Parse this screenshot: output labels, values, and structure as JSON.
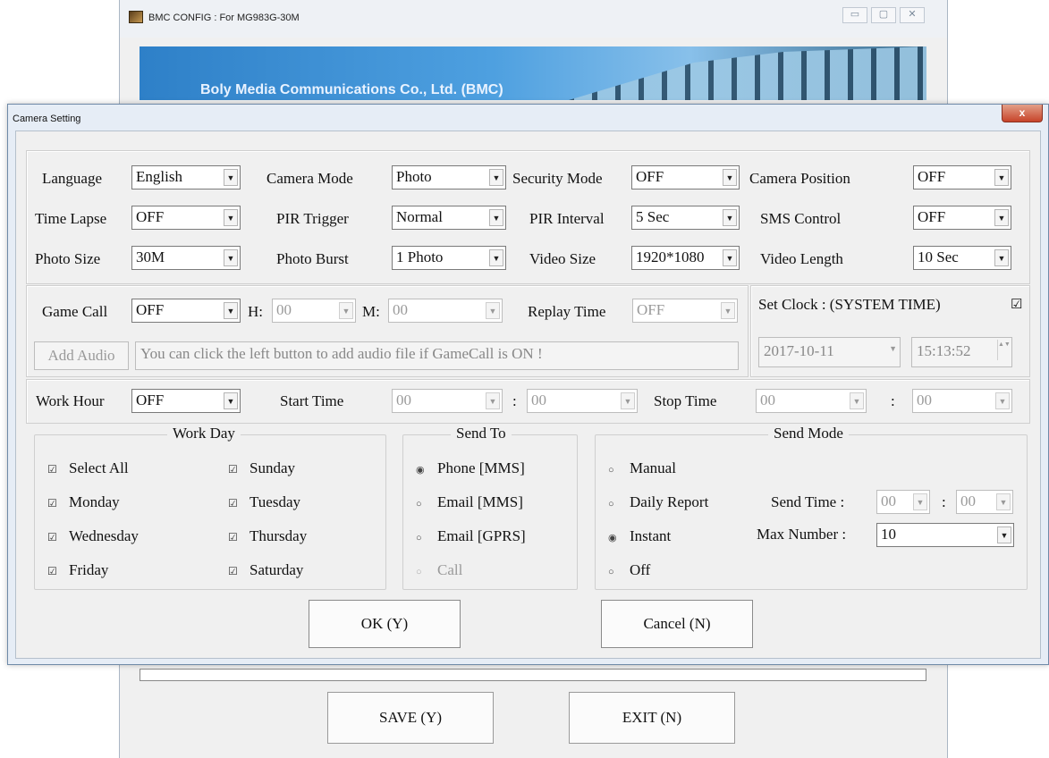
{
  "parent_window": {
    "title": "BMC CONFIG : For MG983G-30M",
    "controls": [
      "▭",
      "▢",
      "✕"
    ],
    "banner_text": "Boly Media Communications Co., Ltd. (BMC)",
    "save_label": "SAVE (Y)",
    "exit_label": "EXIT (N)"
  },
  "dialog": {
    "title": "Camera Setting",
    "close_glyph": "x",
    "row1": {
      "language_label": "Language",
      "language_value": "English",
      "camera_mode_label": "Camera Mode",
      "camera_mode_value": "Photo",
      "security_mode_label": "Security Mode",
      "security_mode_value": "OFF",
      "camera_position_label": "Camera Position",
      "camera_position_value": "OFF"
    },
    "row2": {
      "time_lapse_label": "Time Lapse",
      "time_lapse_value": "OFF",
      "pir_trigger_label": "PIR Trigger",
      "pir_trigger_value": "Normal",
      "pir_interval_label": "PIR Interval",
      "pir_interval_value": "5  Sec",
      "sms_control_label": "SMS Control",
      "sms_control_value": "OFF"
    },
    "row3": {
      "photo_size_label": "Photo Size",
      "photo_size_value": "30M",
      "photo_burst_label": "Photo Burst",
      "photo_burst_value": "1 Photo",
      "video_size_label": "Video Size",
      "video_size_value": "1920*1080",
      "video_length_label": "Video Length",
      "video_length_value": "10  Sec"
    },
    "gamecall": {
      "label": "Game Call",
      "value": "OFF",
      "h_label": "H:",
      "h_value": "00",
      "m_label": "M:",
      "m_value": "00",
      "replay_label": "Replay Time",
      "replay_value": "OFF",
      "add_audio_label": "Add Audio",
      "hint": "You can click the left button to add audio file if GameCall is ON !"
    },
    "clock": {
      "label": "Set Clock  : (SYSTEM TIME)",
      "checked_glyph": "☑",
      "date": "2017-10-11",
      "time": "15:13:52"
    },
    "workhour": {
      "label": "Work Hour",
      "value": "OFF",
      "start_label": "Start Time",
      "start_h": "00",
      "start_m": "00",
      "stop_label": "Stop Time",
      "stop_h": "00",
      "stop_m": "00",
      "sep": ":"
    },
    "workday": {
      "legend": "Work Day",
      "select_all": "Select All",
      "days": [
        "Sunday",
        "Monday",
        "Tuesday",
        "Wednesday",
        "Thursday",
        "Friday",
        "Saturday"
      ],
      "check_glyph": "☑",
      "tick_glyph": "☑"
    },
    "sendto": {
      "legend": "Send To",
      "options": [
        "Phone [MMS]",
        "Email [MMS]",
        "Email [GPRS]",
        "Call"
      ],
      "selected": "Phone [MMS]"
    },
    "sendmode": {
      "legend": "Send Mode",
      "options": [
        "Manual",
        "Daily Report",
        "Instant",
        "Off"
      ],
      "selected": "Instant",
      "send_time_label": "Send Time :",
      "send_time_h": "00",
      "send_time_m": "00",
      "max_number_label": "Max Number :",
      "max_number_value": "10"
    },
    "ok_label": "OK (Y)",
    "cancel_label": "Cancel (N)",
    "dropdown_glyph": "▼",
    "spin_glyph": "▲▼",
    "radio_on": "◉",
    "radio_off": "○"
  }
}
